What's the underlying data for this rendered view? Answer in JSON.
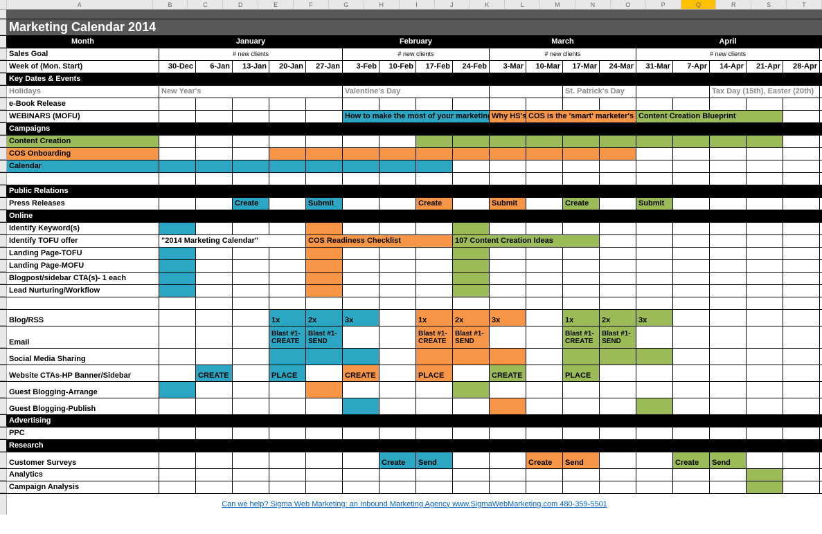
{
  "columns": [
    "",
    "A",
    "B",
    "C",
    "D",
    "E",
    "F",
    "G",
    "H",
    "I",
    "J",
    "K",
    "L",
    "M",
    "N",
    "O",
    "P",
    "Q",
    "R",
    "S",
    "T"
  ],
  "title": "Marketing Calendar 2014",
  "month_label": "Month",
  "months": [
    "January",
    "February",
    "March",
    "April"
  ],
  "sales_label": "Sales Goal",
  "clients_text": "# new clients",
  "week_label": "Week of (Mon. Start)",
  "weeks": [
    "30-Dec",
    "6-Jan",
    "13-Jan",
    "20-Jan",
    "27-Jan",
    "3-Feb",
    "10-Feb",
    "17-Feb",
    "24-Feb",
    "3-Mar",
    "10-Mar",
    "17-Mar",
    "24-Mar",
    "31-Mar",
    "7-Apr",
    "14-Apr",
    "21-Apr",
    "28-Apr"
  ],
  "sections": {
    "key_dates": "Key Dates & Events",
    "campaigns": "Campaigns",
    "public_relations": "Public Relations",
    "online": "Online",
    "advertising": "Advertising",
    "research": "Research"
  },
  "rows": {
    "holidays": "Holidays",
    "holiday_ny": "New Year's",
    "holiday_vd": "Valentine's Day",
    "holiday_sp": "St. Patrick's Day",
    "holiday_apr": "Tax Day (15th), Easter (20th)",
    "ebook": "e-Book Release",
    "webinars": "WEBINARS (MOFU)",
    "webinar1": "How to make the most of your marketing c",
    "webinar2": "Why HS's",
    "webinar2b": "COS is the 'smart' marketer's ch",
    "webinar3": "Content Creation Blueprint",
    "content_creation": "Content Creation",
    "cos_onboarding": "COS Onboarding",
    "calendar": "Calendar",
    "press_releases": "Press Releases",
    "create": "Create",
    "submit": "Submit",
    "identify_kw": "Identify Keyword(s)",
    "identify_tofu": "Identify TOFU offer",
    "tofu_offer1": "\"2014 Marketing Calendar\"",
    "tofu_offer2": "COS Readiness Checklist",
    "tofu_offer3": "107 Content Creation Ideas",
    "landing_tofu": "Landing Page-TOFU",
    "landing_mofu": "Landing Page-MOFU",
    "blogpost_cta": "Blogpost/sidebar CTA(s)- 1 each",
    "lead_nurturing": "Lead Nurturing/Workflow",
    "blog_rss": "Blog/RSS",
    "x1": "1x",
    "x2": "2x",
    "x3": "3x",
    "email": "Email",
    "blast_create": "Blast #1-CREATE",
    "blast_send": "Blast #1-SEND",
    "social": "Social Media Sharing",
    "website_cta": "Website CTAs-HP Banner/Sidebar",
    "cta_create": "CREATE",
    "cta_place": "PLACE",
    "guest_arrange": "Guest Blogging-Arrange",
    "guest_publish": "Guest Blogging-Publish",
    "ppc": "PPC",
    "customer_surveys": "Customer Surveys",
    "send": "Send",
    "analytics": "Analytics",
    "campaign_analysis": "Campaign Analysis"
  },
  "footer": "Can we help? Sigma Web Marketing: an Inbound Marketing Agency   www.SigmaWebMarketing.com   480-359-5501",
  "chart_data": {
    "type": "table",
    "title": "Marketing Calendar 2014",
    "columns": [
      "30-Dec",
      "6-Jan",
      "13-Jan",
      "20-Jan",
      "27-Jan",
      "3-Feb",
      "10-Feb",
      "17-Feb",
      "24-Feb",
      "3-Mar",
      "10-Mar",
      "17-Mar",
      "24-Mar",
      "31-Mar",
      "7-Apr",
      "14-Apr",
      "21-Apr",
      "28-Apr"
    ],
    "column_groups": {
      "January": [
        0,
        1,
        2,
        3,
        4
      ],
      "February": [
        5,
        6,
        7,
        8
      ],
      "March": [
        9,
        10,
        11,
        12
      ],
      "April": [
        13,
        14,
        15,
        16,
        17
      ]
    },
    "rows": [
      {
        "label": "Holidays",
        "cells": {
          "0": "New Year's",
          "5": "Valentine's Day",
          "11": "St. Patrick's Day",
          "15": "Tax Day (15th), Easter (20th)"
        }
      },
      {
        "label": "e-Book Release",
        "cells": {}
      },
      {
        "label": "WEBINARS (MOFU)",
        "cells": {
          "5": {
            "text": "How to make the most of your marketing calendar",
            "color": "teal",
            "span": 4
          },
          "9": {
            "text": "Why HS's",
            "color": "orange"
          },
          "10": {
            "text": "COS is the 'smart' marketer's choice",
            "color": "orange",
            "span": 3
          },
          "13": {
            "text": "Content Creation Blueprint",
            "color": "green",
            "span": 4
          }
        }
      },
      {
        "label": "Content Creation",
        "color": "green",
        "cells": {
          "7": {
            "color": "green"
          },
          "8": {
            "color": "green"
          },
          "9": {
            "color": "green"
          },
          "10": {
            "color": "green"
          },
          "11": {
            "color": "green"
          },
          "12": {
            "color": "green"
          },
          "13": {
            "color": "green"
          },
          "14": {
            "color": "green"
          },
          "15": {
            "color": "green"
          },
          "16": {
            "color": "green"
          }
        }
      },
      {
        "label": "COS Onboarding",
        "color": "orange",
        "cells": {
          "3": {
            "color": "orange"
          },
          "4": {
            "color": "orange"
          },
          "5": {
            "color": "orange"
          },
          "6": {
            "color": "orange"
          },
          "7": {
            "color": "orange"
          },
          "8": {
            "color": "orange"
          },
          "9": {
            "color": "orange"
          },
          "10": {
            "color": "orange"
          },
          "11": {
            "color": "orange"
          },
          "12": {
            "color": "orange"
          }
        }
      },
      {
        "label": "Calendar",
        "color": "teal",
        "cells": {
          "0": {
            "color": "teal"
          },
          "1": {
            "color": "teal"
          },
          "2": {
            "color": "teal"
          },
          "3": {
            "color": "teal"
          },
          "4": {
            "color": "teal"
          },
          "5": {
            "color": "teal"
          },
          "6": {
            "color": "teal"
          },
          "7": {
            "color": "teal"
          }
        }
      },
      {
        "label": "Press Releases",
        "cells": {
          "2": {
            "text": "Create",
            "color": "teal"
          },
          "4": {
            "text": "Submit",
            "color": "teal"
          },
          "7": {
            "text": "Create",
            "color": "orange"
          },
          "9": {
            "text": "Submit",
            "color": "orange"
          },
          "11": {
            "text": "Create",
            "color": "green"
          },
          "13": {
            "text": "Submit",
            "color": "green"
          }
        }
      },
      {
        "label": "Identify Keyword(s)",
        "cells": {
          "0": {
            "color": "teal"
          },
          "4": {
            "color": "orange"
          },
          "8": {
            "color": "green"
          }
        }
      },
      {
        "label": "Identify TOFU offer",
        "cells": {
          "0": {
            "text": "\"2014 Marketing Calendar\"",
            "span": 4
          },
          "4": {
            "text": "COS Readiness Checklist",
            "color": "orange",
            "span": 4
          },
          "8": {
            "text": "107 Content Creation Ideas",
            "color": "green",
            "span": 4
          }
        }
      },
      {
        "label": "Landing Page-TOFU",
        "cells": {
          "0": {
            "color": "teal"
          },
          "4": {
            "color": "orange"
          },
          "8": {
            "color": "green"
          }
        }
      },
      {
        "label": "Landing Page-MOFU",
        "cells": {
          "0": {
            "color": "teal"
          },
          "4": {
            "color": "orange"
          },
          "8": {
            "color": "green"
          }
        }
      },
      {
        "label": "Blogpost/sidebar CTA(s)- 1 each",
        "cells": {
          "0": {
            "color": "teal"
          },
          "4": {
            "color": "orange"
          },
          "8": {
            "color": "green"
          }
        }
      },
      {
        "label": "Lead Nurturing/Workflow",
        "cells": {
          "0": {
            "color": "teal"
          },
          "4": {
            "color": "orange"
          },
          "8": {
            "color": "green"
          }
        }
      },
      {
        "label": "Blog/RSS",
        "cells": {
          "3": {
            "text": "1x",
            "color": "teal"
          },
          "4": {
            "text": "2x",
            "color": "teal"
          },
          "5": {
            "text": "3x",
            "color": "teal"
          },
          "7": {
            "text": "1x",
            "color": "orange"
          },
          "8": {
            "text": "2x",
            "color": "orange"
          },
          "9": {
            "text": "3x",
            "color": "orange"
          },
          "11": {
            "text": "1x",
            "color": "green"
          },
          "12": {
            "text": "2x",
            "color": "green"
          },
          "13": {
            "text": "3x",
            "color": "green"
          }
        }
      },
      {
        "label": "Email",
        "cells": {
          "3": {
            "text": "Blast #1-CREATE",
            "color": "teal"
          },
          "4": {
            "text": "Blast #1-SEND",
            "color": "teal"
          },
          "7": {
            "text": "Blast #1-CREATE",
            "color": "orange"
          },
          "8": {
            "text": "Blast #1-SEND",
            "color": "orange"
          },
          "11": {
            "text": "Blast #1-CREATE",
            "color": "green"
          },
          "12": {
            "text": "Blast #1-SEND",
            "color": "green"
          }
        }
      },
      {
        "label": "Social Media Sharing",
        "cells": {
          "3": {
            "color": "teal"
          },
          "4": {
            "color": "teal"
          },
          "5": {
            "color": "teal"
          },
          "7": {
            "color": "orange"
          },
          "8": {
            "color": "orange"
          },
          "9": {
            "color": "orange"
          },
          "11": {
            "color": "green"
          },
          "12": {
            "color": "green"
          },
          "13": {
            "color": "green"
          }
        }
      },
      {
        "label": "Website CTAs-HP Banner/Sidebar",
        "cells": {
          "1": {
            "text": "CREATE",
            "color": "teal"
          },
          "3": {
            "text": "PLACE",
            "color": "teal"
          },
          "5": {
            "text": "CREATE",
            "color": "orange"
          },
          "7": {
            "text": "PLACE",
            "color": "orange"
          },
          "9": {
            "text": "CREATE",
            "color": "green"
          },
          "11": {
            "text": "PLACE",
            "color": "green"
          }
        }
      },
      {
        "label": "Guest Blogging-Arrange",
        "cells": {
          "0": {
            "color": "teal"
          },
          "4": {
            "color": "orange"
          },
          "8": {
            "color": "green"
          }
        }
      },
      {
        "label": "Guest Blogging-Publish",
        "cells": {
          "5": {
            "color": "teal"
          },
          "9": {
            "color": "orange"
          },
          "13": {
            "color": "green"
          }
        }
      },
      {
        "label": "PPC",
        "cells": {}
      },
      {
        "label": "Customer Surveys",
        "cells": {
          "6": {
            "text": "Create",
            "color": "teal"
          },
          "7": {
            "text": "Send",
            "color": "teal"
          },
          "10": {
            "text": "Create",
            "color": "orange"
          },
          "11": {
            "text": "Send",
            "color": "orange"
          },
          "14": {
            "text": "Create",
            "color": "green"
          },
          "15": {
            "text": "Send",
            "color": "green"
          }
        }
      },
      {
        "label": "Analytics",
        "cells": {
          "16": {
            "color": "green"
          }
        }
      },
      {
        "label": "Campaign Analysis",
        "cells": {
          "16": {
            "color": "green"
          }
        }
      }
    ]
  }
}
